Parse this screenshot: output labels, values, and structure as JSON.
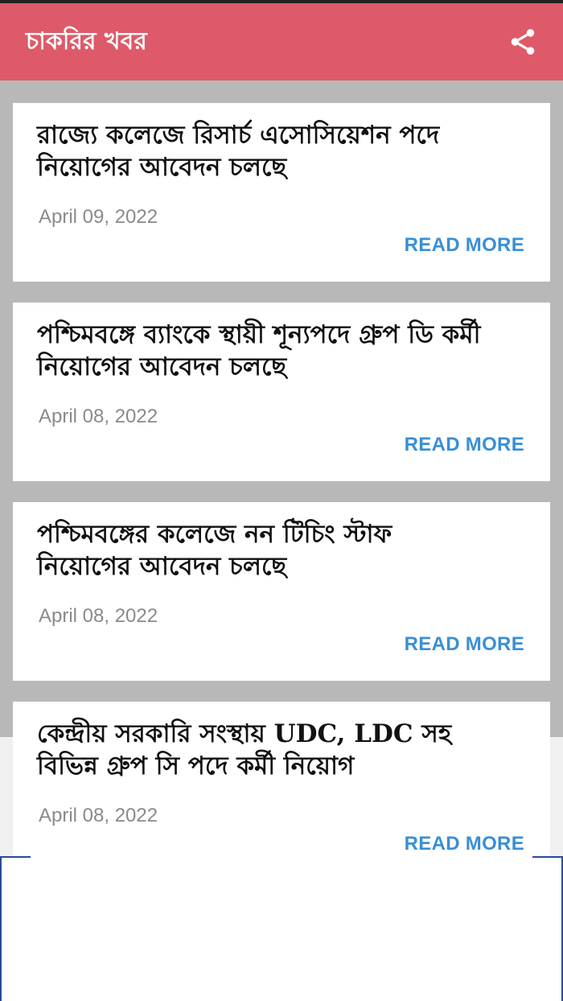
{
  "app": {
    "title": "চাকরির খবর",
    "share_icon": "share-icon",
    "accent_color": "#de5a6a",
    "link_color": "#3a8fd6"
  },
  "posts": [
    {
      "title": "রাজ্যে কলেজে রিসার্চ এসোসিয়েশন পদে নিয়োগের আবেদন চলছে",
      "date": "April 09, 2022",
      "more": "READ MORE"
    },
    {
      "title": "পশ্চিমবঙ্গে ব্যাংকে স্থায়ী শূন্যপদে গ্রুপ ডি কর্মী নিয়োগের আবেদন চলছে",
      "date": "April 08, 2022",
      "more": "READ MORE"
    },
    {
      "title": "পশ্চিমবঙ্গের কলেজে নন টিচিং স্টাফ নিয়োগের আবেদন চলছে",
      "date": "April 08, 2022",
      "more": "READ MORE"
    },
    {
      "title": "কেন্দ্রীয় সরকারি সংস্থায় UDC, LDC সহ বিভিন্ন গ্রুপ সি পদে কর্মী নিয়োগ",
      "date": "April 08, 2022",
      "more": "READ MORE"
    }
  ]
}
